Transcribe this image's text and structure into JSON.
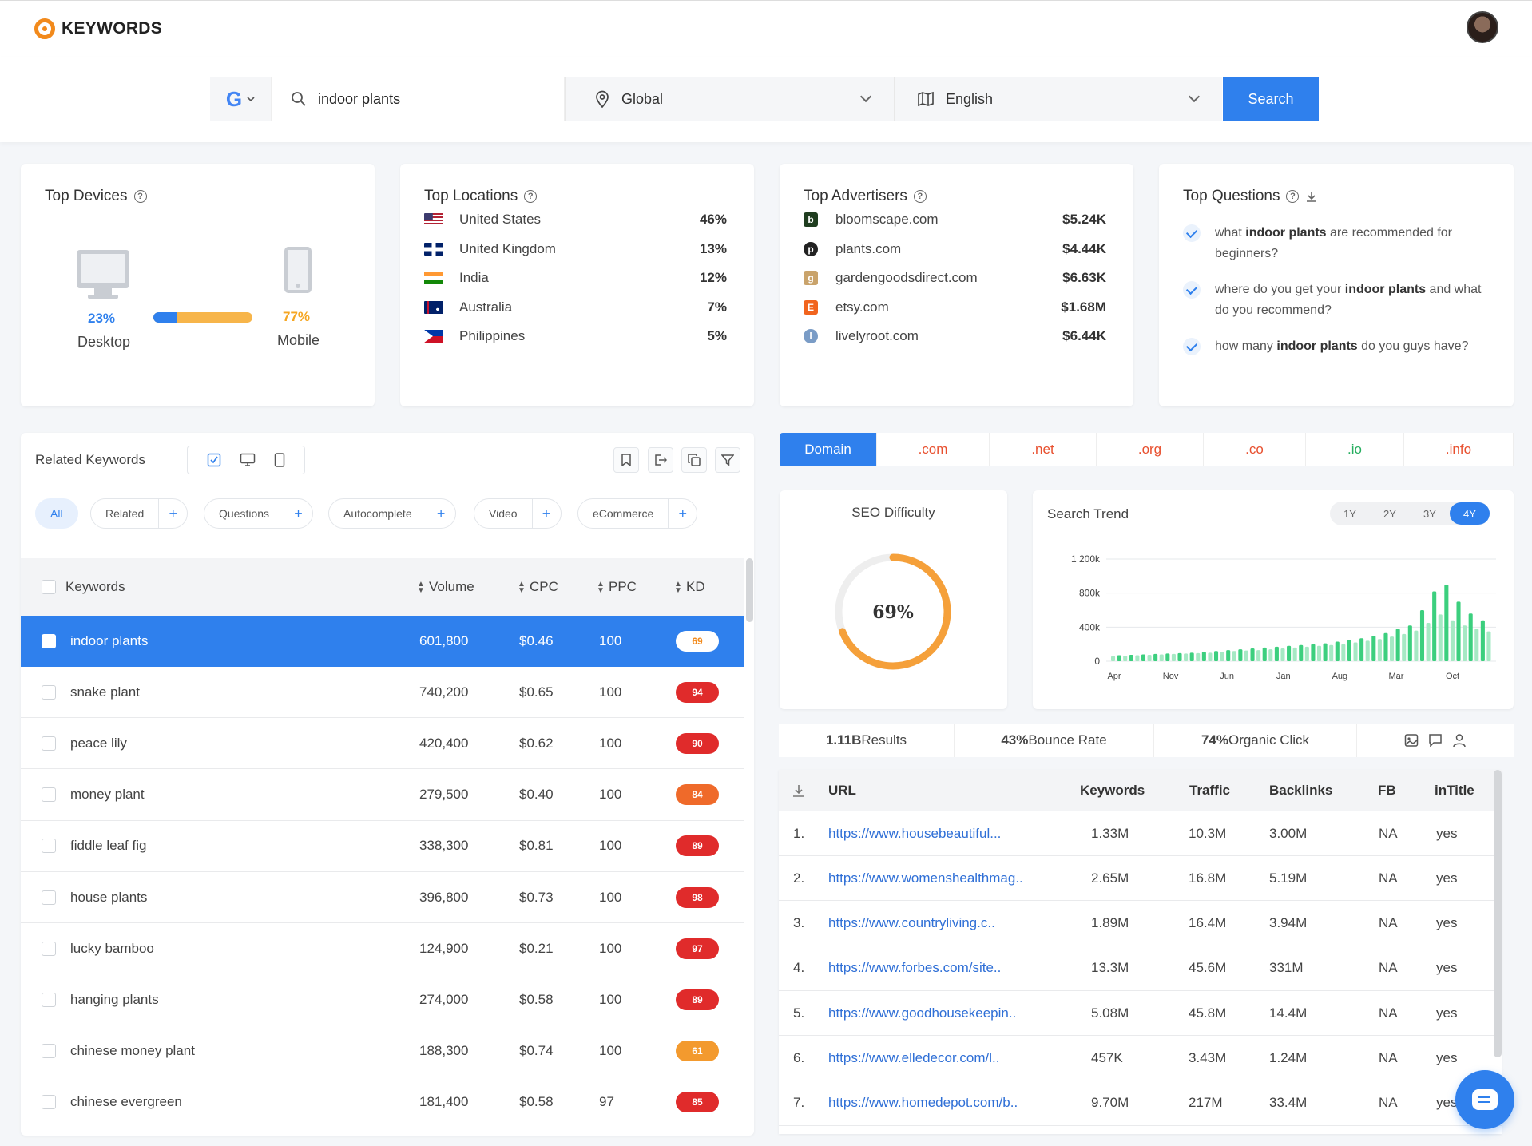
{
  "app": {
    "logo_text": "KEYWORDS"
  },
  "search": {
    "engine": "Google",
    "engine_letter": "G",
    "query": "indoor plants",
    "location": "Global",
    "language": "English",
    "button": "Search"
  },
  "devices": {
    "title": "Top Devices",
    "desktop_pct": "23%",
    "desktop_fraction": 0.23,
    "desktop_label": "Desktop",
    "mobile_pct": "77%",
    "mobile_label": "Mobile"
  },
  "locations": {
    "title": "Top Locations",
    "items": [
      {
        "name": "United States",
        "value": "46%",
        "flag": "us"
      },
      {
        "name": "United Kingdom",
        "value": "13%",
        "flag": "uk"
      },
      {
        "name": "India",
        "value": "12%",
        "flag": "in"
      },
      {
        "name": "Australia",
        "value": "7%",
        "flag": "au"
      },
      {
        "name": "Philippines",
        "value": "5%",
        "flag": "ph"
      }
    ]
  },
  "advertisers": {
    "title": "Top Advertisers",
    "items": [
      {
        "name": "bloomscape.com",
        "value": "$5.24K",
        "icon": "b",
        "color": "#1f3d1f"
      },
      {
        "name": "plants.com",
        "value": "$4.44K",
        "icon": "p",
        "color": "#222222"
      },
      {
        "name": "gardengoodsdirect.com",
        "value": "$6.63K",
        "icon": "g",
        "color": "#c9a36b"
      },
      {
        "name": "etsy.com",
        "value": "$1.68M",
        "icon": "E",
        "color": "#f1641e"
      },
      {
        "name": "livelyroot.com",
        "value": "$6.44K",
        "icon": "l",
        "color": "#7a9cc6"
      }
    ]
  },
  "questions": {
    "title": "Top Questions",
    "items": [
      {
        "pre": "what ",
        "bold": "indoor plants",
        "post": " are recommended for beginners?"
      },
      {
        "pre": "where do you get your ",
        "bold": "indoor plants",
        "post": " and what do you recommend?"
      },
      {
        "pre": "how many ",
        "bold": "indoor plants",
        "post": " do you guys have?"
      }
    ]
  },
  "related": {
    "title": "Related Keywords",
    "chips": [
      "All",
      "Related",
      "Questions",
      "Autocomplete",
      "Video",
      "eCommerce"
    ],
    "columns": {
      "keyword": "Keywords",
      "volume": "Volume",
      "cpc": "CPC",
      "ppc": "PPC",
      "kd": "KD"
    },
    "rows": [
      {
        "keyword": "indoor plants",
        "volume": "601,800",
        "cpc": "$0.46",
        "ppc": "100",
        "kd": "69",
        "kd_color": "#ffffff",
        "kd_text": "#f28a1c"
      },
      {
        "keyword": "snake plant",
        "volume": "740,200",
        "cpc": "$0.65",
        "ppc": "100",
        "kd": "94",
        "kd_color": "#e02b2b",
        "kd_text": "#ffffff"
      },
      {
        "keyword": "peace lily",
        "volume": "420,400",
        "cpc": "$0.62",
        "ppc": "100",
        "kd": "90",
        "kd_color": "#e02b2b",
        "kd_text": "#ffffff"
      },
      {
        "keyword": "money plant",
        "volume": "279,500",
        "cpc": "$0.40",
        "ppc": "100",
        "kd": "84",
        "kd_color": "#ef6a2a",
        "kd_text": "#ffffff"
      },
      {
        "keyword": "fiddle leaf fig",
        "volume": "338,300",
        "cpc": "$0.81",
        "ppc": "100",
        "kd": "89",
        "kd_color": "#e02b2b",
        "kd_text": "#ffffff"
      },
      {
        "keyword": "house plants",
        "volume": "396,800",
        "cpc": "$0.73",
        "ppc": "100",
        "kd": "98",
        "kd_color": "#e02b2b",
        "kd_text": "#ffffff"
      },
      {
        "keyword": "lucky bamboo",
        "volume": "124,900",
        "cpc": "$0.21",
        "ppc": "100",
        "kd": "97",
        "kd_color": "#e02b2b",
        "kd_text": "#ffffff"
      },
      {
        "keyword": "hanging plants",
        "volume": "274,000",
        "cpc": "$0.58",
        "ppc": "100",
        "kd": "89",
        "kd_color": "#e02b2b",
        "kd_text": "#ffffff"
      },
      {
        "keyword": "chinese money plant",
        "volume": "188,300",
        "cpc": "$0.74",
        "ppc": "100",
        "kd": "61",
        "kd_color": "#f39a2e",
        "kd_text": "#ffffff"
      },
      {
        "keyword": "chinese evergreen",
        "volume": "181,400",
        "cpc": "$0.58",
        "ppc": "97",
        "kd": "85",
        "kd_color": "#e02b2b",
        "kd_text": "#ffffff"
      }
    ]
  },
  "domains": {
    "tabs": [
      {
        "label": "Domain",
        "color": "#ffffff"
      },
      {
        "label": ".com",
        "color": "#e8502f"
      },
      {
        "label": ".net",
        "color": "#e8502f"
      },
      {
        "label": ".org",
        "color": "#e8502f"
      },
      {
        "label": ".co",
        "color": "#e8502f"
      },
      {
        "label": ".io",
        "color": "#27ae60"
      },
      {
        "label": ".info",
        "color": "#e8502f"
      }
    ]
  },
  "seo": {
    "title": "SEO Difficulty",
    "value_label": "69%",
    "value": 69
  },
  "trend": {
    "title": "Search Trend",
    "ranges": [
      "1Y",
      "2Y",
      "3Y",
      "4Y"
    ],
    "active_range": "4Y"
  },
  "chart_data": {
    "type": "bar",
    "title": "Search Trend",
    "y_ticks": [
      "0",
      "400k",
      "800k",
      "1 200k"
    ],
    "x_ticks": [
      "Apr",
      "Nov",
      "Jun",
      "Jan",
      "Aug",
      "Mar",
      "Oct"
    ],
    "ylim": [
      0,
      1200000
    ],
    "grid": true,
    "series": [
      {
        "values": [
          60000,
          70000,
          65000,
          75000,
          70000,
          80000,
          75000,
          85000,
          80000,
          90000,
          85000,
          95000,
          90000,
          100000,
          95000,
          110000,
          100000,
          120000,
          110000,
          130000,
          120000,
          140000,
          125000,
          150000,
          130000,
          160000,
          140000,
          170000,
          150000,
          180000,
          160000,
          190000,
          170000,
          200000,
          180000,
          210000,
          190000,
          230000,
          200000,
          250000,
          220000,
          270000,
          240000,
          300000,
          260000,
          330000,
          290000,
          380000,
          320000,
          420000,
          360000,
          600000,
          450000,
          820000,
          550000,
          900000,
          480000,
          700000,
          420000,
          560000,
          380000,
          480000,
          350000
        ],
        "colors": {
          "light": "#a6e9c4",
          "dark": "#3ccf7e"
        }
      }
    ]
  },
  "stats": {
    "results_bold": "1.11B",
    "results_label": " Results",
    "bounce_bold": "43%",
    "bounce_label": " Bounce Rate",
    "organic_bold": "74%",
    "organic_label": " Organic Click"
  },
  "urls": {
    "columns": {
      "url": "URL",
      "keywords": "Keywords",
      "traffic": "Traffic",
      "backlinks": "Backlinks",
      "fb": "FB",
      "intitle": "inTitle"
    },
    "rows": [
      {
        "n": "1.",
        "url": "https://www.housebeautiful...",
        "keywords": "1.33M",
        "traffic": "10.3M",
        "backlinks": "3.00M",
        "fb": "NA",
        "intitle": "yes"
      },
      {
        "n": "2.",
        "url": "https://www.womenshealthmag..",
        "keywords": "2.65M",
        "traffic": "16.8M",
        "backlinks": "5.19M",
        "fb": "NA",
        "intitle": "yes"
      },
      {
        "n": "3.",
        "url": "https://www.countryliving.c..",
        "keywords": "1.89M",
        "traffic": "16.4M",
        "backlinks": "3.94M",
        "fb": "NA",
        "intitle": "yes"
      },
      {
        "n": "4.",
        "url": "https://www.forbes.com/site..",
        "keywords": "13.3M",
        "traffic": "45.6M",
        "backlinks": "331M",
        "fb": "NA",
        "intitle": "yes"
      },
      {
        "n": "5.",
        "url": "https://www.goodhousekeepin..",
        "keywords": "5.08M",
        "traffic": "45.8M",
        "backlinks": "14.4M",
        "fb": "NA",
        "intitle": "yes"
      },
      {
        "n": "6.",
        "url": "https://www.elledecor.com/l..",
        "keywords": "457K",
        "traffic": "3.43M",
        "backlinks": "1.24M",
        "fb": "NA",
        "intitle": "yes"
      },
      {
        "n": "7.",
        "url": "https://www.homedepot.com/b..",
        "keywords": "9.70M",
        "traffic": "217M",
        "backlinks": "33.4M",
        "fb": "NA",
        "intitle": "yes"
      }
    ]
  }
}
